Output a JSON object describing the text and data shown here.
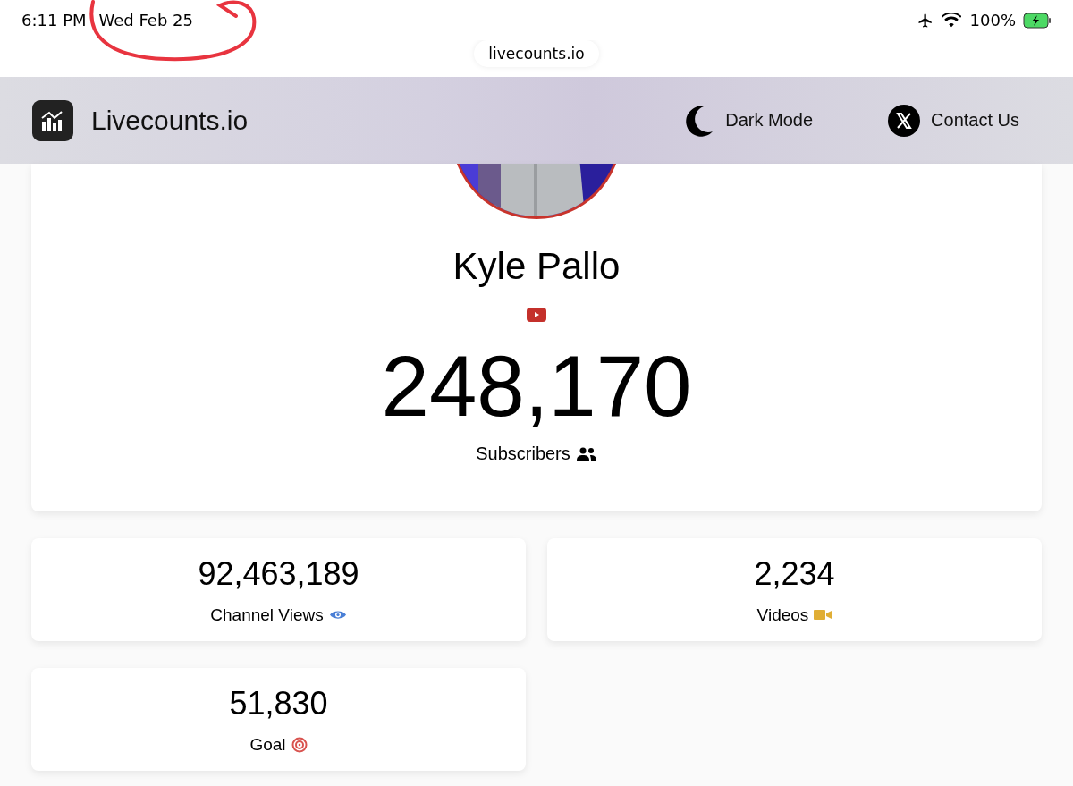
{
  "status_bar": {
    "time": "6:11 PM",
    "date": "Wed Feb 25",
    "battery": "100%"
  },
  "address_bar": {
    "url": "livecounts.io"
  },
  "header": {
    "brand": "Livecounts.io",
    "actions": [
      {
        "kind": "moon",
        "label": "Dark Mode"
      },
      {
        "kind": "x",
        "label": "Contact Us"
      }
    ]
  },
  "profile": {
    "name": "Kyle Pallo",
    "count": "248,170",
    "count_label": "Subscribers"
  },
  "stats": [
    {
      "kind": "eye",
      "value": "92,463,189",
      "label": "Channel Views"
    },
    {
      "kind": "video",
      "value": "2,234",
      "label": "Videos"
    },
    {
      "kind": "target",
      "value": "51,830",
      "label": "Goal"
    }
  ]
}
